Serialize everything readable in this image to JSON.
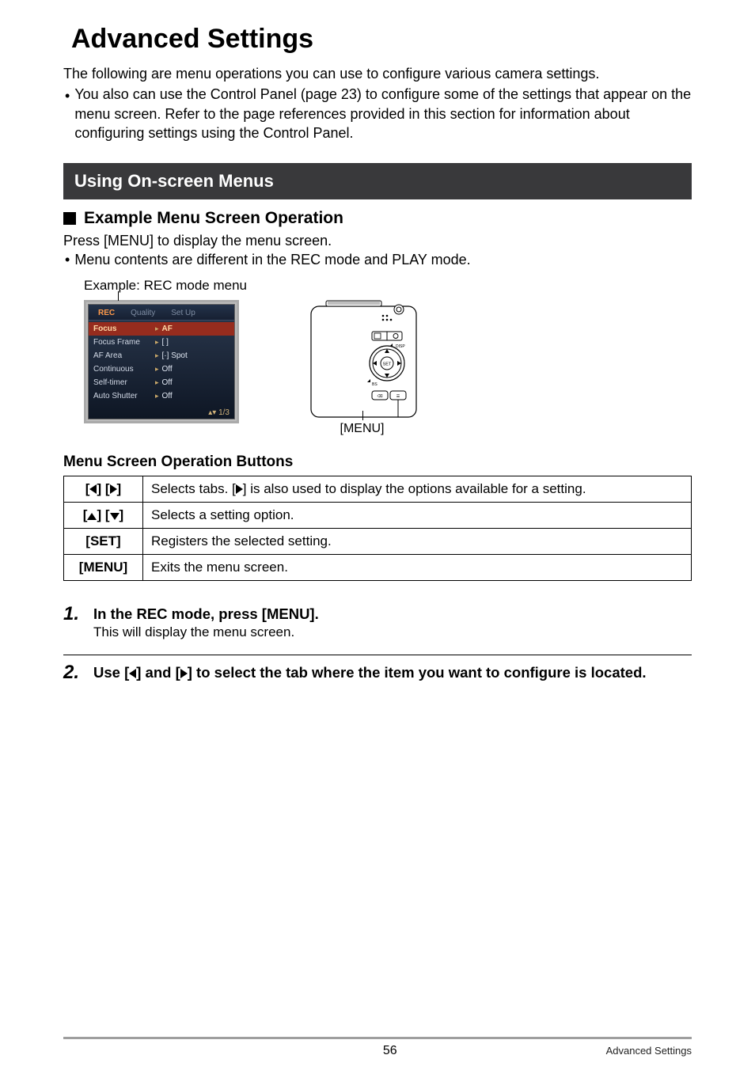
{
  "pageTitle": "Advanced Settings",
  "intro": "The following are menu operations you can use to configure various camera settings.",
  "introBullet": "You also can use the Control Panel (page 23) to configure some of the settings that appear on the menu screen. Refer to the page references provided in this section for information about configuring settings using the Control Panel.",
  "section1": {
    "heading": "Using On-screen Menus"
  },
  "sub1": {
    "heading": "Example Menu Screen Operation",
    "p1": "Press [MENU] to display the menu screen.",
    "p2": "Menu contents are different in the REC mode and PLAY mode.",
    "exampleLabel": "Example: REC mode menu",
    "menuLabel": "[MENU]"
  },
  "lcd": {
    "tabs": [
      "REC",
      "Quality",
      "Set Up"
    ],
    "rows": [
      {
        "label": "Focus",
        "value": "AF"
      },
      {
        "label": "Focus Frame",
        "value": "[ ]"
      },
      {
        "label": "AF Area",
        "value": "[·] Spot"
      },
      {
        "label": "Continuous",
        "value": "Off"
      },
      {
        "label": "Self-timer",
        "value": "Off"
      },
      {
        "label": "Auto Shutter",
        "value": "Off"
      }
    ],
    "footer": "1/3"
  },
  "tableTitle": "Menu Screen Operation Buttons",
  "table": {
    "r1": {
      "key": "[  ] [  ]",
      "desc_a": "Selects tabs. [",
      "desc_b": "] is also used to display the options available for a setting."
    },
    "r2": {
      "key": "[  ] [  ]",
      "desc": "Selects a setting option."
    },
    "r3": {
      "key": "[SET]",
      "desc": "Registers the selected setting."
    },
    "r4": {
      "key": "[MENU]",
      "desc": "Exits the menu screen."
    }
  },
  "steps": {
    "s1": {
      "num": "1.",
      "title": "In the REC mode, press [MENU].",
      "desc": "This will display the menu screen."
    },
    "s2": {
      "num": "2.",
      "title_a": "Use [",
      "title_b": "] and [",
      "title_c": "] to select the tab where the item you want to configure is located."
    }
  },
  "footer": {
    "pageNumber": "56",
    "label": "Advanced Settings"
  }
}
